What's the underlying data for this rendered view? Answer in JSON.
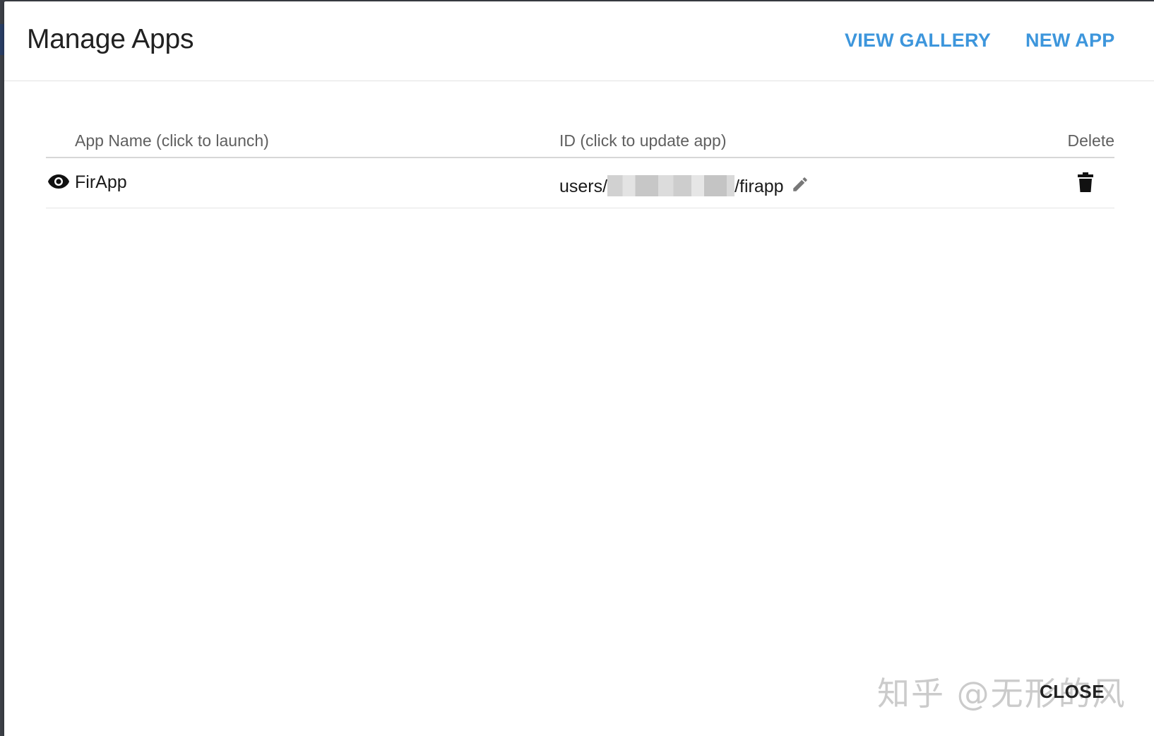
{
  "dialog": {
    "title": "Manage Apps",
    "actions": {
      "view_gallery": "VIEW GALLERY",
      "new_app": "NEW APP"
    },
    "close_label": "CLOSE"
  },
  "table": {
    "columns": {
      "name": "App Name (click to launch)",
      "id": "ID (click to update app)",
      "delete": "Delete"
    },
    "rows": [
      {
        "name": "FirApp",
        "id_prefix": "users/",
        "id_suffix": "/firapp"
      }
    ]
  },
  "icons": {
    "launch": "eye-icon",
    "edit": "pencil-icon",
    "delete": "trash-icon"
  },
  "watermark": "知乎 @无形的风",
  "colors": {
    "accent": "#3d96dc",
    "text": "#212121"
  }
}
